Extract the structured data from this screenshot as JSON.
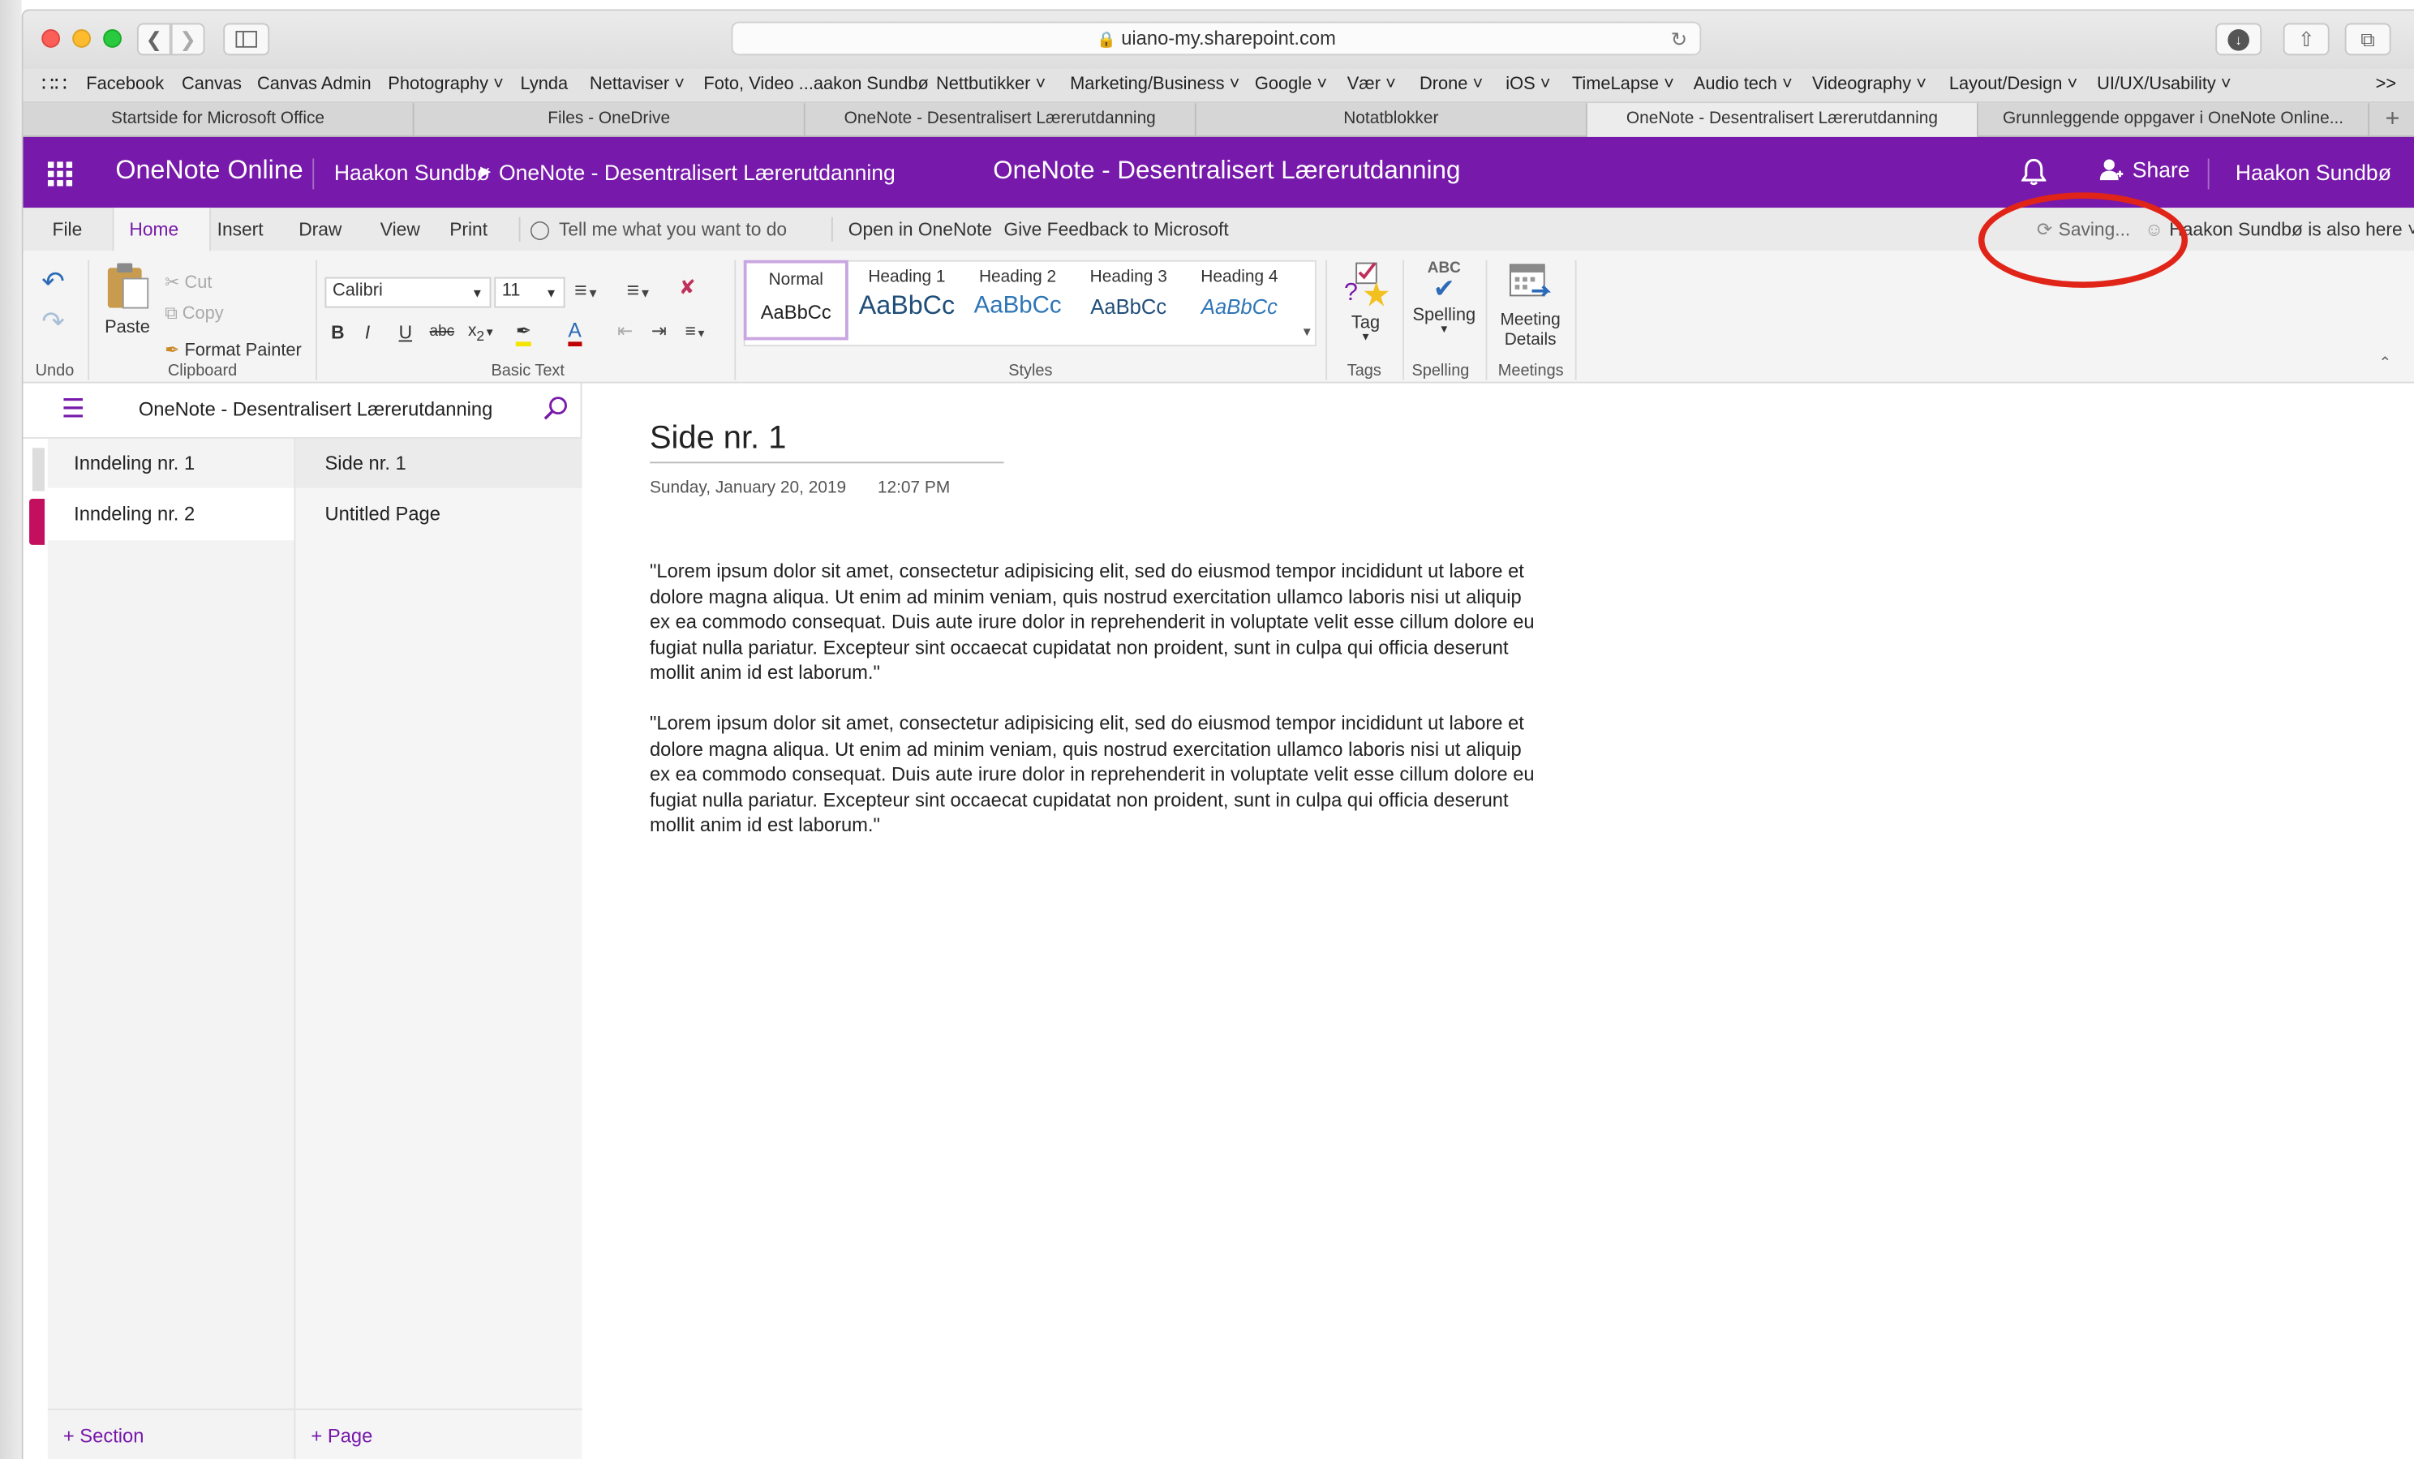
{
  "browser": {
    "url": "uiano-my.sharepoint.com",
    "bookmarks": [
      "Facebook",
      "Canvas",
      "Canvas Admin",
      "Photography",
      "Lynda",
      "Nettaviser",
      "Foto, Video ...aakon Sundbø",
      "Nettbutikker",
      "Marketing/Business",
      "Google",
      "Vær",
      "Drone",
      "iOS",
      "TimeLapse",
      "Audio tech",
      "Videography",
      "Layout/Design",
      "UI/UX/Usability"
    ],
    "tabs": [
      "Startside for Microsoft Office",
      "Files - OneDrive",
      "OneNote - Desentralisert Lærerutdanning",
      "Notatblokker",
      "OneNote - Desentralisert Lærerutdanning",
      "Grunnleggende oppgaver i OneNote Online..."
    ]
  },
  "header": {
    "app_name": "OneNote Online",
    "breadcrumb_user": "Haakon Sundbø",
    "breadcrumb_notebook": "OneNote - Desentralisert Lærerutdanning",
    "title": "OneNote - Desentralisert Lærerutdanning",
    "share": "Share",
    "user": "Haakon Sundbø"
  },
  "menu": {
    "items": [
      "File",
      "Home",
      "Insert",
      "Draw",
      "View",
      "Print"
    ],
    "tell_me": "Tell me what you want to do",
    "open_in_onenote": "Open in OneNote",
    "feedback": "Give Feedback to Microsoft",
    "saving": "Saving...",
    "presence": "Haakon Sundbø is also here"
  },
  "ribbon": {
    "undo_label": "Undo",
    "paste": "Paste",
    "cut": "Cut",
    "copy": "Copy",
    "format_painter": "Format Painter",
    "clipboard_label": "Clipboard",
    "font": "Calibri",
    "size": "11",
    "basic_text_label": "Basic Text",
    "styles": [
      {
        "name": "Normal",
        "sample": "AaBbCc"
      },
      {
        "name": "Heading 1",
        "sample": "AaBbCc"
      },
      {
        "name": "Heading 2",
        "sample": "AaBbCc"
      },
      {
        "name": "Heading 3",
        "sample": "AaBbCc"
      },
      {
        "name": "Heading 4",
        "sample": "AaBbCc"
      }
    ],
    "styles_label": "Styles",
    "tag": "Tag",
    "tags_label": "Tags",
    "spelling": "Spelling",
    "spelling_abc": "ABC",
    "spelling_label": "Spelling",
    "meeting_line1": "Meeting",
    "meeting_line2": "Details",
    "meetings_label": "Meetings"
  },
  "nav": {
    "notebook": "OneNote - Desentralisert Lærerutdanning",
    "sections": [
      "Inndeling nr. 1",
      "Inndeling nr. 2"
    ],
    "pages": [
      "Side nr. 1",
      "Untitled Page"
    ],
    "add_section": "Section",
    "add_page": "Page"
  },
  "page": {
    "title": "Side nr. 1",
    "date": "Sunday, January 20, 2019",
    "time": "12:07 PM",
    "paragraphs": [
      "\"Lorem ipsum dolor sit amet, consectetur adipisicing elit, sed do eiusmod tempor incididunt ut labore et dolore magna aliqua. Ut enim ad minim veniam, quis nostrud exercitation ullamco laboris nisi ut aliquip ex ea commodo consequat. Duis aute irure dolor in reprehenderit in voluptate velit esse cillum dolore eu fugiat nulla pariatur. Excepteur sint occaecat cupidatat non proident, sunt in culpa qui officia deserunt mollit anim id est laborum.\"",
      "\"Lorem ipsum dolor sit amet, consectetur adipisicing elit, sed do eiusmod tempor incididunt ut labore et dolore magna aliqua. Ut enim ad minim veniam, quis nostrud exercitation ullamco laboris nisi ut aliquip ex ea commodo consequat. Duis aute irure dolor in reprehenderit in voluptate velit esse cillum dolore eu fugiat nulla pariatur. Excepteur sint occaecat cupidatat non proident, sunt in culpa qui officia deserunt mollit anim id est laborum.\""
    ]
  },
  "colors": {
    "accent": "#7719aa",
    "annotation": "#e02418",
    "section_marker": "#c3105e"
  }
}
